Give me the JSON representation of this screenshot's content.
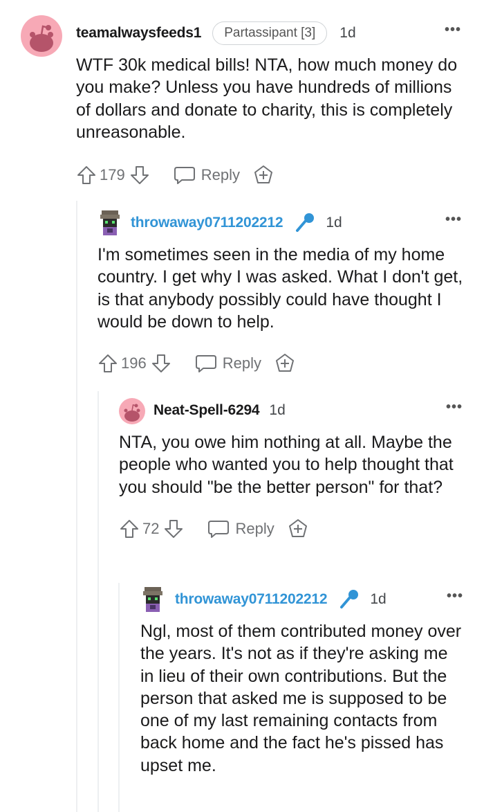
{
  "comments": [
    {
      "username": "teamalwaysfeeds1",
      "flair": "Partassipant [3]",
      "age": "1d",
      "more": "•••",
      "body": "WTF 30k medical bills! NTA, how much money do you make? Unless you have hundreds of millions of dollars and donate to charity, this is completely unreasonable.",
      "score": "179",
      "reply_label": "Reply",
      "avatar_icon": "snoo-avatar-icon"
    },
    {
      "username": "throwaway0711202212",
      "is_op": true,
      "age": "1d",
      "more": "•••",
      "body": "I'm sometimes seen in the media of my home country. I get why I was asked. What I don't get, is that anybody possibly could have thought I would be down to help.",
      "score": "196",
      "reply_label": "Reply",
      "avatar_icon": "pixel-avatar-icon"
    },
    {
      "username": "Neat-Spell-6294",
      "age": "1d",
      "more": "•••",
      "body": "NTA, you owe him nothing at all. Maybe the people who wanted you to help thought that you should \"be the better person\" for that?",
      "score": "72",
      "reply_label": "Reply",
      "avatar_icon": "snoo-avatar-icon"
    },
    {
      "username": "throwaway0711202212",
      "is_op": true,
      "age": "1d",
      "more": "•••",
      "body": "Ngl, most of them contributed money over the years. It's not as if they're asking me in lieu of their own contributions. But the person that asked me is supposed to be one of my last remaining contacts from back home and the fact he's pissed has upset me.",
      "avatar_icon": "pixel-avatar-icon"
    }
  ],
  "colors": {
    "op_username": "#3194d6",
    "avatar_bg": "#f7a9b6",
    "thread_line": "#edeff1",
    "meta_text": "#6f7174"
  }
}
